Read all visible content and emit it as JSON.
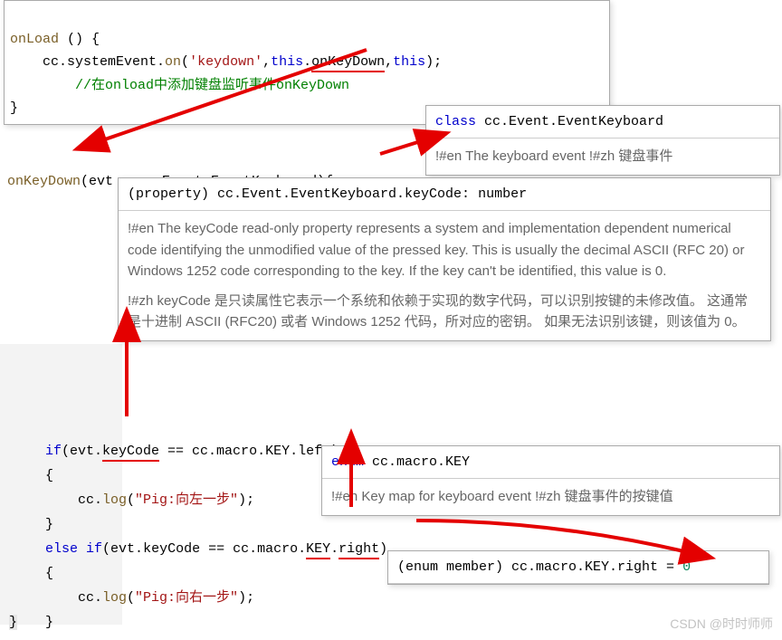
{
  "top": {
    "l1_onload": "onLoad",
    "l1_open": " () {",
    "l2_prefix": "    cc.systemEvent.",
    "l2_on": "on",
    "l2_openp": "(",
    "l2_str": "'keydown'",
    "l2_c1": ",",
    "l2_this1": "this",
    "l2_dot": ".",
    "l2_okd": "onKeyDown",
    "l2_c2": ",",
    "l2_this2": "this",
    "l2_close": ");",
    "l3_cmt": "        //在onload中添加键盘监听事件onKeyDown",
    "l4": "}"
  },
  "onkey": {
    "name": "onKeyDown",
    "open": "(evt : cc.Event.",
    "evk": "EventKeyboard",
    "close": "){"
  },
  "tip_class": {
    "header_kw": "class",
    "header_rest": " cc.Event.EventKeyboard",
    "body": "!#en The keyboard event !#zh 键盘事件"
  },
  "tip_keycode": {
    "header": "(property) cc.Event.EventKeyboard.keyCode: number",
    "en": "!#en The keyCode read-only property represents a system and implementation dependent numerical code identifying the unmodified value of the pressed key. This is usually the decimal ASCII (RFC 20) or Windows 1252 code corresponding to the key. If the key can't be identified, this value is 0.",
    "zh": "!#zh keyCode 是只读属性它表示一个系统和依赖于实现的数字代码，可以识别按键的未修改值。 这通常是十进制 ASCII (RFC20) 或者 Windows 1252 代码，所对应的密钥。 如果无法识别该键，则该值为 0。"
  },
  "mid": {
    "if_kw": "if",
    "if_open": "(evt.",
    "keycode": "keyCode",
    "eq": " == cc.macro.KEY.",
    "left": "left",
    "if_close": ")",
    "brace_open": "{",
    "log_prefix": "    cc.",
    "log_fn": "log",
    "log_left_open": "(",
    "log_left_str": "\"Pig:向左一步\"",
    "log_left_close": ");",
    "brace_close": "}",
    "else_kw": "else",
    "space": " ",
    "if_kw2": "if",
    "right": "right",
    "log_right_str": "\"Pig:向右一步\"",
    "last_brace": "}"
  },
  "tip_enum": {
    "header_kw": "enum",
    "header_rest": " cc.macro.KEY",
    "body": "!#en Key map for keyboard event !#zh 键盘事件的按键值"
  },
  "tip_member": {
    "text": "(enum member) cc.macro.KEY.right = ",
    "val": "0"
  },
  "watermark": "CSDN @时时师师"
}
